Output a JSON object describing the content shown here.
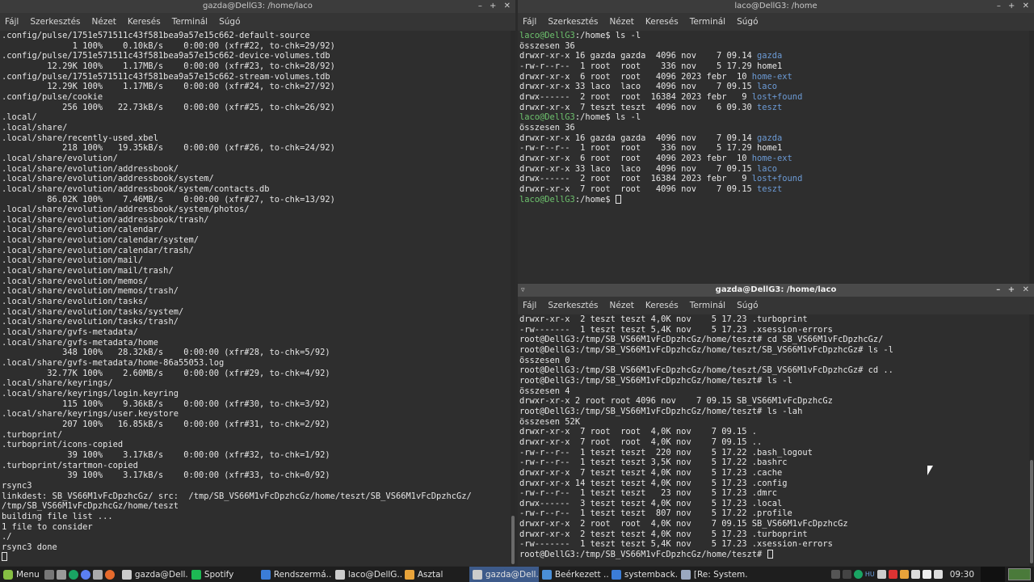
{
  "window_left": {
    "title": "gazda@DellG3: /home/laco",
    "controls": "– + ✕",
    "menu": [
      "Fájl",
      "Szerkesztés",
      "Nézet",
      "Keresés",
      "Terminál",
      "Súgó"
    ],
    "lines": [
      ".config/pulse/1751e571511c43f581bea9a57e15c662-default-source",
      "              1 100%    0.10kB/s    0:00:00 (xfr#22, to-chk=29/92)",
      ".config/pulse/1751e571511c43f581bea9a57e15c662-device-volumes.tdb",
      "         12.29K 100%    1.17MB/s    0:00:00 (xfr#23, to-chk=28/92)",
      ".config/pulse/1751e571511c43f581bea9a57e15c662-stream-volumes.tdb",
      "         12.29K 100%    1.17MB/s    0:00:00 (xfr#24, to-chk=27/92)",
      ".config/pulse/cookie",
      "            256 100%   22.73kB/s    0:00:00 (xfr#25, to-chk=26/92)",
      ".local/",
      ".local/share/",
      ".local/share/recently-used.xbel",
      "            218 100%   19.35kB/s    0:00:00 (xfr#26, to-chk=24/92)",
      ".local/share/evolution/",
      ".local/share/evolution/addressbook/",
      ".local/share/evolution/addressbook/system/",
      ".local/share/evolution/addressbook/system/contacts.db",
      "         86.02K 100%    7.46MB/s    0:00:00 (xfr#27, to-chk=13/92)",
      ".local/share/evolution/addressbook/system/photos/",
      ".local/share/evolution/addressbook/trash/",
      ".local/share/evolution/calendar/",
      ".local/share/evolution/calendar/system/",
      ".local/share/evolution/calendar/trash/",
      ".local/share/evolution/mail/",
      ".local/share/evolution/mail/trash/",
      ".local/share/evolution/memos/",
      ".local/share/evolution/memos/trash/",
      ".local/share/evolution/tasks/",
      ".local/share/evolution/tasks/system/",
      ".local/share/evolution/tasks/trash/",
      ".local/share/gvfs-metadata/",
      ".local/share/gvfs-metadata/home",
      "            348 100%   28.32kB/s    0:00:00 (xfr#28, to-chk=5/92)",
      ".local/share/gvfs-metadata/home-86a55053.log",
      "         32.77K 100%    2.60MB/s    0:00:00 (xfr#29, to-chk=4/92)",
      ".local/share/keyrings/",
      ".local/share/keyrings/login.keyring",
      "            115 100%    9.36kB/s    0:00:00 (xfr#30, to-chk=3/92)",
      ".local/share/keyrings/user.keystore",
      "            207 100%   16.85kB/s    0:00:00 (xfr#31, to-chk=2/92)",
      ".turboprint/",
      ".turboprint/icons-copied",
      "             39 100%    3.17kB/s    0:00:00 (xfr#32, to-chk=1/92)",
      ".turboprint/startmon-copied",
      "             39 100%    3.17kB/s    0:00:00 (xfr#33, to-chk=0/92)",
      "rsync3",
      "linkdest: SB_VS66M1vFcDpzhcGz/ src:  /tmp/SB_VS66M1vFcDpzhcGz/home/teszt/SB_VS66M1vFcDpzhcGz/",
      "/tmp/SB_VS66M1vFcDpzhcGz/home/teszt",
      "building file list ...",
      "1 file to consider",
      "./",
      "rsync3 done"
    ]
  },
  "window_top_right": {
    "title": "laco@DellG3: /home",
    "controls": "– + ✕",
    "menu": [
      "Fájl",
      "Szerkesztés",
      "Nézet",
      "Keresés",
      "Terminál",
      "Súgó"
    ],
    "prompt": "laco@DellG3",
    "prompt_path": ":/home$",
    "blocks": [
      {
        "command": " ls -l",
        "total": "összesen 36",
        "rows": [
          {
            "text": "drwxr-xr-x 16 gazda gazda  4096 nov    7 09.14 ",
            "name": "gazda",
            "dir": true
          },
          {
            "text": "-rw-r--r--  1 root  root    336 nov    5 17.29 ",
            "name": "home1",
            "dir": false
          },
          {
            "text": "drwxr-xr-x  6 root  root   4096 2023 febr  10 ",
            "name": "home-ext",
            "dir": true
          },
          {
            "text": "drwxr-xr-x 33 laco  laco   4096 nov    7 09.15 ",
            "name": "laco",
            "dir": true
          },
          {
            "text": "drwx------  2 root  root  16384 2023 febr   9 ",
            "name": "lost+found",
            "dir": true
          },
          {
            "text": "drwxr-xr-x  7 teszt teszt  4096 nov    6 09.30 ",
            "name": "teszt",
            "dir": true
          }
        ]
      },
      {
        "command": " ls -l",
        "total": "összesen 36",
        "rows": [
          {
            "text": "drwxr-xr-x 16 gazda gazda  4096 nov    7 09.14 ",
            "name": "gazda",
            "dir": true
          },
          {
            "text": "-rw-r--r--  1 root  root    336 nov    5 17.29 ",
            "name": "home1",
            "dir": false
          },
          {
            "text": "drwxr-xr-x  6 root  root   4096 2023 febr  10 ",
            "name": "home-ext",
            "dir": true
          },
          {
            "text": "drwxr-xr-x 33 laco  laco   4096 nov    7 09.15 ",
            "name": "laco",
            "dir": true
          },
          {
            "text": "drwx------  2 root  root  16384 2023 febr   9 ",
            "name": "lost+found",
            "dir": true
          },
          {
            "text": "drwxr-xr-x  7 root  root   4096 nov    7 09.15 ",
            "name": "teszt",
            "dir": true
          }
        ]
      }
    ]
  },
  "window_bottom_right": {
    "title": "gazda@DellG3: /home/laco",
    "menu_glyph": "▿",
    "controls": "– + ✕",
    "menu": [
      "Fájl",
      "Szerkesztés",
      "Nézet",
      "Keresés",
      "Terminál",
      "Súgó"
    ],
    "lines": [
      "drwxr-xr-x  2 teszt teszt 4,0K nov    5 17.23 .turboprint",
      "-rw-------  1 teszt teszt 5,4K nov    5 17.23 .xsession-errors",
      "root@DellG3:/tmp/SB_VS66M1vFcDpzhcGz/home/teszt# cd SB_VS66M1vFcDpzhcGz/",
      "root@DellG3:/tmp/SB_VS66M1vFcDpzhcGz/home/teszt/SB_VS66M1vFcDpzhcGz# ls -l",
      "összesen 0",
      "root@DellG3:/tmp/SB_VS66M1vFcDpzhcGz/home/teszt/SB_VS66M1vFcDpzhcGz# cd ..",
      "root@DellG3:/tmp/SB_VS66M1vFcDpzhcGz/home/teszt# ls -l",
      "összesen 4",
      "drwxr-xr-x 2 root root 4096 nov    7 09.15 SB_VS66M1vFcDpzhcGz",
      "root@DellG3:/tmp/SB_VS66M1vFcDpzhcGz/home/teszt# ls -lah",
      "összesen 52K",
      "drwxr-xr-x  7 root  root  4,0K nov    7 09.15 .",
      "drwxr-xr-x  7 root  root  4,0K nov    7 09.15 ..",
      "-rw-r--r--  1 teszt teszt  220 nov    5 17.22 .bash_logout",
      "-rw-r--r--  1 teszt teszt 3,5K nov    5 17.22 .bashrc",
      "drwxr-xr-x  7 teszt teszt 4,0K nov    5 17.23 .cache",
      "drwxr-xr-x 14 teszt teszt 4,0K nov    5 17.23 .config",
      "-rw-r--r--  1 teszt teszt   23 nov    5 17.23 .dmrc",
      "drwx------  3 teszt teszt 4,0K nov    5 17.23 .local",
      "-rw-r--r--  1 teszt teszt  807 nov    5 17.22 .profile",
      "drwxr-xr-x  2 root  root  4,0K nov    7 09.15 SB_VS66M1vFcDpzhcGz",
      "drwxr-xr-x  2 teszt teszt 4,0K nov    5 17.23 .turboprint",
      "-rw-------  1 teszt teszt 5,4K nov    5 17.23 .xsession-errors"
    ],
    "final_prompt": "root@DellG3:/tmp/SB_VS66M1vFcDpzhcGz/home/teszt# "
  },
  "taskbar": {
    "menu_label": "Menu",
    "tasks": [
      {
        "label": "gazda@Dell...",
        "icon": "terminal-icon",
        "color": "#cccccc",
        "active": false
      },
      {
        "label": "Spotify",
        "icon": "spotify-icon",
        "color": "#1db954",
        "active": false
      },
      {
        "label": "Rendszermá...",
        "icon": "system-monitor-icon",
        "color": "#3b7dd8",
        "active": false
      },
      {
        "label": "laco@DellG...",
        "icon": "terminal-icon",
        "color": "#cccccc",
        "active": false
      },
      {
        "label": "Asztal",
        "icon": "folder-icon",
        "color": "#e8a33a",
        "active": false
      },
      {
        "label": "gazda@Dell...",
        "icon": "terminal-icon",
        "color": "#cccccc",
        "active": true
      },
      {
        "label": "Beérkezett ...",
        "icon": "mail-icon",
        "color": "#4a8fd8",
        "active": false
      },
      {
        "label": "systemback...",
        "icon": "systemback-icon",
        "color": "#3b7dd8",
        "active": false
      },
      {
        "label": "[Re: System...",
        "icon": "editor-icon",
        "color": "#9aa8c0",
        "active": false
      }
    ],
    "lang": "HU",
    "clock": "09:30"
  },
  "colors": {
    "prompt_green": "#6dc16d",
    "dir_blue": "#6c9bd6",
    "terminal_bg": "#2e2e2e",
    "active_task": "#3d5a8a"
  }
}
